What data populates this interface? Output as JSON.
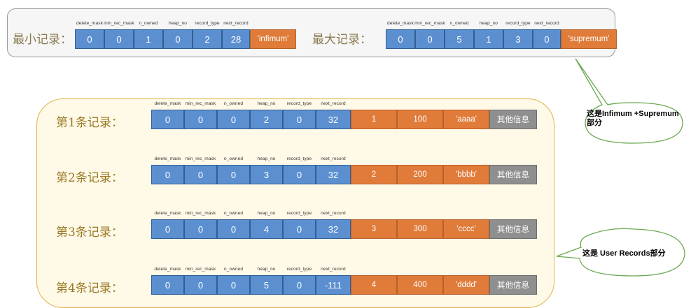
{
  "header_fields": [
    "delete_mask",
    "min_rec_mask",
    "n_owned",
    "heap_no",
    "record_type",
    "next_record"
  ],
  "infimum": {
    "label": "最小记录：",
    "values": [
      "0",
      "0",
      "1",
      "0",
      "2",
      "28"
    ],
    "data": "'infimum'"
  },
  "supremum": {
    "label": "最大记录：",
    "values": [
      "0",
      "0",
      "5",
      "1",
      "3",
      "0"
    ],
    "data": "'supremum'"
  },
  "records": [
    {
      "label": "第1条记录：",
      "values": [
        "0",
        "0",
        "0",
        "2",
        "0",
        "32"
      ],
      "col1": "1",
      "col2": "100",
      "col3": "'aaaa'",
      "other": "其他信息"
    },
    {
      "label": "第2条记录：",
      "values": [
        "0",
        "0",
        "0",
        "3",
        "0",
        "32"
      ],
      "col1": "2",
      "col2": "200",
      "col3": "'bbbb'",
      "other": "其他信息"
    },
    {
      "label": "第3条记录：",
      "values": [
        "0",
        "0",
        "0",
        "4",
        "0",
        "32"
      ],
      "col1": "3",
      "col2": "300",
      "col3": "'cccc'",
      "other": "其他信息"
    },
    {
      "label": "第4条记录：",
      "values": [
        "0",
        "0",
        "0",
        "5",
        "0",
        "-111"
      ],
      "col1": "4",
      "col2": "400",
      "col3": "'dddd'",
      "other": "其他信息"
    }
  ],
  "callouts": {
    "infimum_supremum": "这是Infimum +Supremum部分",
    "user_records": "这是 User Records部分"
  },
  "colors": {
    "header_cell": "#5b8fd0",
    "data_cell": "#e07b3a",
    "other_cell": "#8f8f8f",
    "infimum_box_border": "#9a9a9a",
    "user_box_border": "#e2b24b",
    "label_text": "#9a7a24"
  }
}
